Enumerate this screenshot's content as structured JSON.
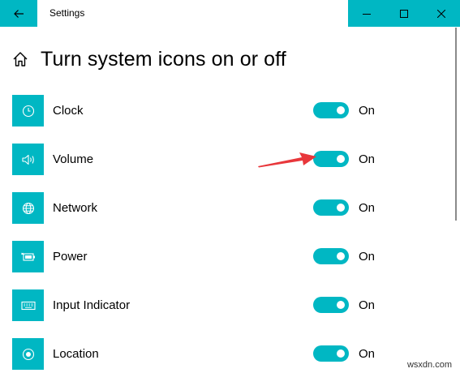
{
  "window": {
    "title": "Settings",
    "accent": "#00b7c3",
    "back_icon": "back-arrow-icon",
    "controls": [
      "minimize-icon",
      "maximize-icon",
      "close-icon"
    ]
  },
  "header": {
    "icon": "home-icon",
    "title": "Turn system icons on or off"
  },
  "items": [
    {
      "label": "Clock",
      "icon": "clock-icon",
      "state": "On"
    },
    {
      "label": "Volume",
      "icon": "speaker-icon",
      "state": "On"
    },
    {
      "label": "Network",
      "icon": "globe-icon",
      "state": "On"
    },
    {
      "label": "Power",
      "icon": "battery-icon",
      "state": "On"
    },
    {
      "label": "Input Indicator",
      "icon": "keyboard-icon",
      "state": "On"
    },
    {
      "label": "Location",
      "icon": "location-icon",
      "state": "On"
    }
  ],
  "annotation": {
    "icon": "red-arrow-icon",
    "color": "#e8373b"
  },
  "watermark": "wsxdn.com"
}
